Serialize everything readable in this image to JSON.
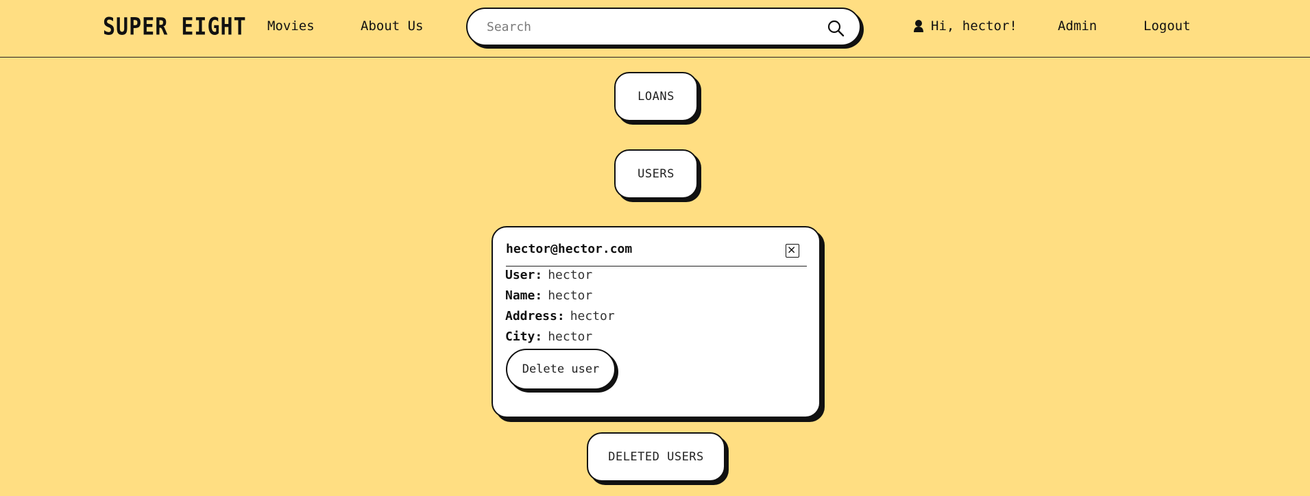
{
  "header": {
    "logo": "SUPER EIGHT",
    "nav": {
      "movies": "Movies",
      "about": "About Us",
      "admin": "Admin",
      "logout": "Logout"
    },
    "search": {
      "placeholder": "Search",
      "value": "",
      "icon": "search-icon"
    },
    "greeting": "Hi, hector!",
    "user_icon": "user-icon"
  },
  "main": {
    "loans_button": "LOANS",
    "users_button": "USERS",
    "deleted_users_button": "DELETED USERS"
  },
  "user_card": {
    "email": "hector@hector.com",
    "close_icon": "close-icon",
    "fields": {
      "user": {
        "label": "User:",
        "value": "hector"
      },
      "name": {
        "label": "Name:",
        "value": "hector"
      },
      "address": {
        "label": "Address:",
        "value": "hector"
      },
      "city": {
        "label": "City:",
        "value": "hector"
      }
    },
    "delete_button": "Delete user"
  },
  "colors": {
    "background": "#ffde82",
    "surface": "#ffffff",
    "ink": "#111111"
  }
}
